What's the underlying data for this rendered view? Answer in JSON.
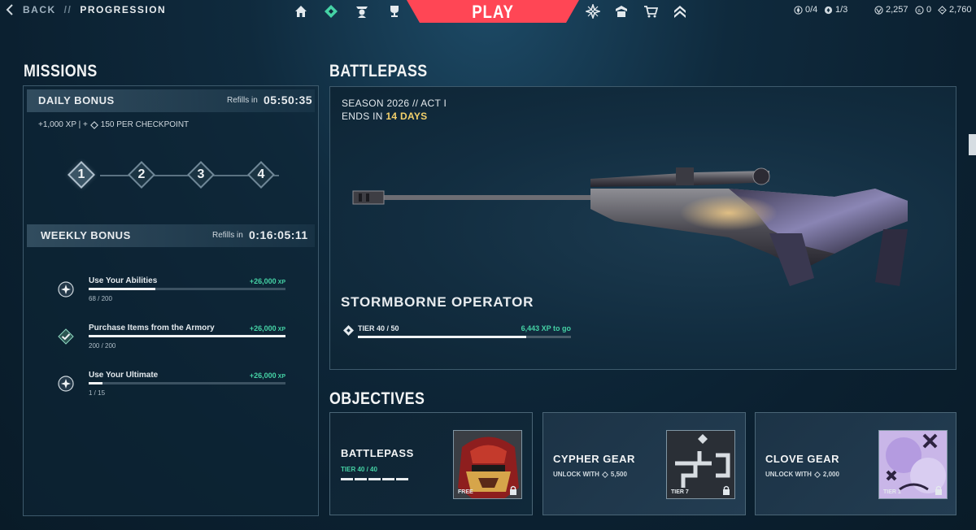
{
  "topbar": {
    "back_label": "BACK",
    "separator": "//",
    "crumb": "PROGRESSION",
    "play_label": "PLAY",
    "nav_left": [
      "home-icon",
      "battlepass-icon",
      "agents-icon",
      "trophy-icon"
    ],
    "nav_right": [
      "collection-icon",
      "social-icon",
      "store-icon",
      "rank-icon"
    ],
    "currencies": [
      {
        "icon": "radianite-icon",
        "value": "0/4"
      },
      {
        "icon": "kingdom-icon",
        "value": "1/3"
      },
      {
        "icon": "valorant-points-icon",
        "value": "2,257"
      },
      {
        "icon": "radianite-points-icon",
        "value": "0"
      },
      {
        "icon": "kingdom-credits-icon",
        "value": "2,760"
      }
    ]
  },
  "missions": {
    "heading": "MISSIONS",
    "daily": {
      "title": "DAILY BONUS",
      "refill_label": "Refills in",
      "timer": "05:50:35",
      "desc_left": "+1,000 XP | +",
      "desc_right": "150 PER CHECKPOINT",
      "checkpoints": [
        "1",
        "2",
        "3",
        "4"
      ]
    },
    "weekly": {
      "title": "WEEKLY BONUS",
      "refill_label": "Refills in",
      "timer": "0:16:05:11",
      "items": [
        {
          "name": "Use Your Abilities",
          "xp": "+26,000",
          "unit": "XP",
          "count": "68 / 200",
          "progress": 0.34,
          "icon": "sparkle-icon"
        },
        {
          "name": "Purchase Items from the Armory",
          "xp": "+26,000",
          "unit": "XP",
          "count": "200 / 200",
          "progress": 1.0,
          "icon": "check-icon"
        },
        {
          "name": "Use Your Ultimate",
          "xp": "+26,000",
          "unit": "XP",
          "count": "1 / 15",
          "progress": 0.07,
          "icon": "sparkle-icon"
        }
      ]
    }
  },
  "battlepass": {
    "heading": "BATTLEPASS",
    "season": "SEASON 2026 // ACT I",
    "ends_prefix": "ENDS IN",
    "ends_value": "14 DAYS",
    "item_name": "STORMBORNE OPERATOR",
    "tier_label": "TIER 40 / 50",
    "xp_to_go": "6,443 XP to go",
    "progress": 0.79
  },
  "objectives": {
    "heading": "OBJECTIVES",
    "cards": [
      {
        "title": "BATTLEPASS",
        "sub": "TIER 40 / 40",
        "tag": "FREE"
      },
      {
        "title": "CYPHER GEAR",
        "sub_prefix": "UNLOCK WITH",
        "sub_value": "5,500",
        "tag": "TIER 7"
      },
      {
        "title": "CLOVE GEAR",
        "sub_prefix": "UNLOCK WITH",
        "sub_value": "2,000",
        "tag": "TIER 1"
      }
    ]
  },
  "colors": {
    "accent_green": "#45d2a5",
    "play_red": "#ff4655",
    "highlight_gold": "#f3d06b"
  }
}
